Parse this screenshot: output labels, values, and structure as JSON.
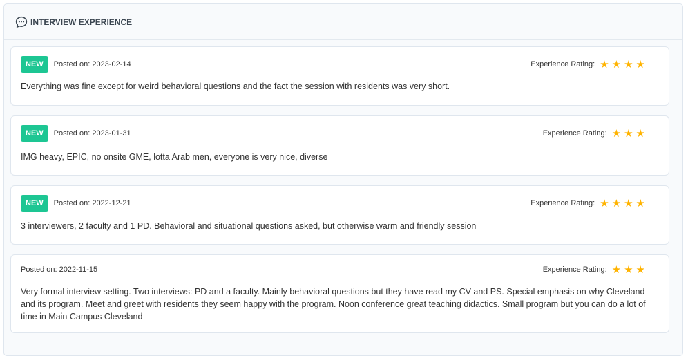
{
  "header": {
    "title": "INTERVIEW EXPERIENCE",
    "icon": "chat-bubble-icon"
  },
  "colors": {
    "badge": "#1dc693",
    "star": "#ffb300",
    "border": "#dfe6ee",
    "panel_bg": "#f8fafc"
  },
  "reviews": [
    {
      "badge": "NEW",
      "posted": "Posted on: 2023-02-14",
      "rating_label": "Experience Rating:",
      "rating": 4,
      "text": "Everything was fine except for weird behavioral questions and the fact the session with residents was very short."
    },
    {
      "badge": "NEW",
      "posted": "Posted on: 2023-01-31",
      "rating_label": "Experience Rating:",
      "rating": 3,
      "text": "IMG heavy, EPIC, no onsite GME, lotta Arab men, everyone is very nice, diverse"
    },
    {
      "badge": "NEW",
      "posted": "Posted on: 2022-12-21",
      "rating_label": "Experience Rating:",
      "rating": 4,
      "text": "3 interviewers, 2 faculty and 1 PD. Behavioral and situational questions asked, but otherwise warm and friendly session"
    },
    {
      "badge": "",
      "posted": "Posted on: 2022-11-15",
      "rating_label": "Experience Rating:",
      "rating": 3,
      "text": "Very formal interview setting. Two interviews: PD and a faculty. Mainly behavioral questions but they have read my CV and PS. Special emphasis on why Cleveland and its program. Meet and greet with residents they seem happy with the program. Noon conference great teaching didactics. Small program but you can do a lot of time in Main Campus Cleveland"
    }
  ]
}
